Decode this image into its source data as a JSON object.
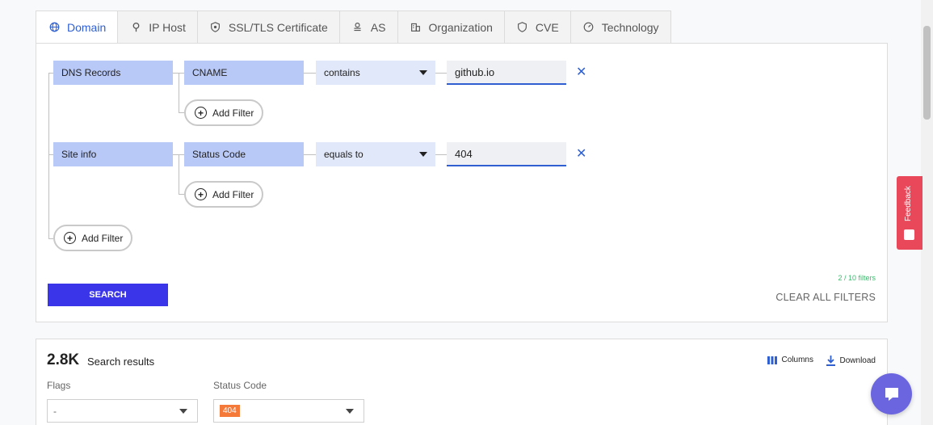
{
  "tabs": [
    {
      "label": "Domain",
      "icon": "globe-icon",
      "active": true
    },
    {
      "label": "IP Host",
      "icon": "location-pin-icon"
    },
    {
      "label": "SSL/TLS Certificate",
      "icon": "shield-icon"
    },
    {
      "label": "AS",
      "icon": "network-icon"
    },
    {
      "label": "Organization",
      "icon": "building-icon"
    },
    {
      "label": "CVE",
      "icon": "shield-outline-icon"
    },
    {
      "label": "Technology",
      "icon": "gauge-icon"
    }
  ],
  "filters": [
    {
      "category": "DNS Records",
      "field": "CNAME",
      "operator": "contains",
      "value": "github.io",
      "add_label": "Add Filter"
    },
    {
      "category": "Site info",
      "field": "Status Code",
      "operator": "equals to",
      "value": "404",
      "add_label": "Add Filter"
    }
  ],
  "root_add_label": "Add Filter",
  "search_label": "SEARCH",
  "filter_count": "2 / 10 filters",
  "clear_all_label": "CLEAR ALL FILTERS",
  "results": {
    "count": "2.8K",
    "label": "Search results",
    "columns_label": "Columns",
    "download_label": "Download",
    "flags_label": "Flags",
    "flags_value": "-",
    "status_label": "Status Code",
    "status_value": "404"
  },
  "feedback_label": "Feedback",
  "colors": {
    "accent": "#2f5fd0",
    "search_button": "#3a35e8",
    "category_bg": "#b9c9f7",
    "badge": "#f57a3a",
    "feedback": "#e8485a",
    "chat": "#6b66e0"
  }
}
